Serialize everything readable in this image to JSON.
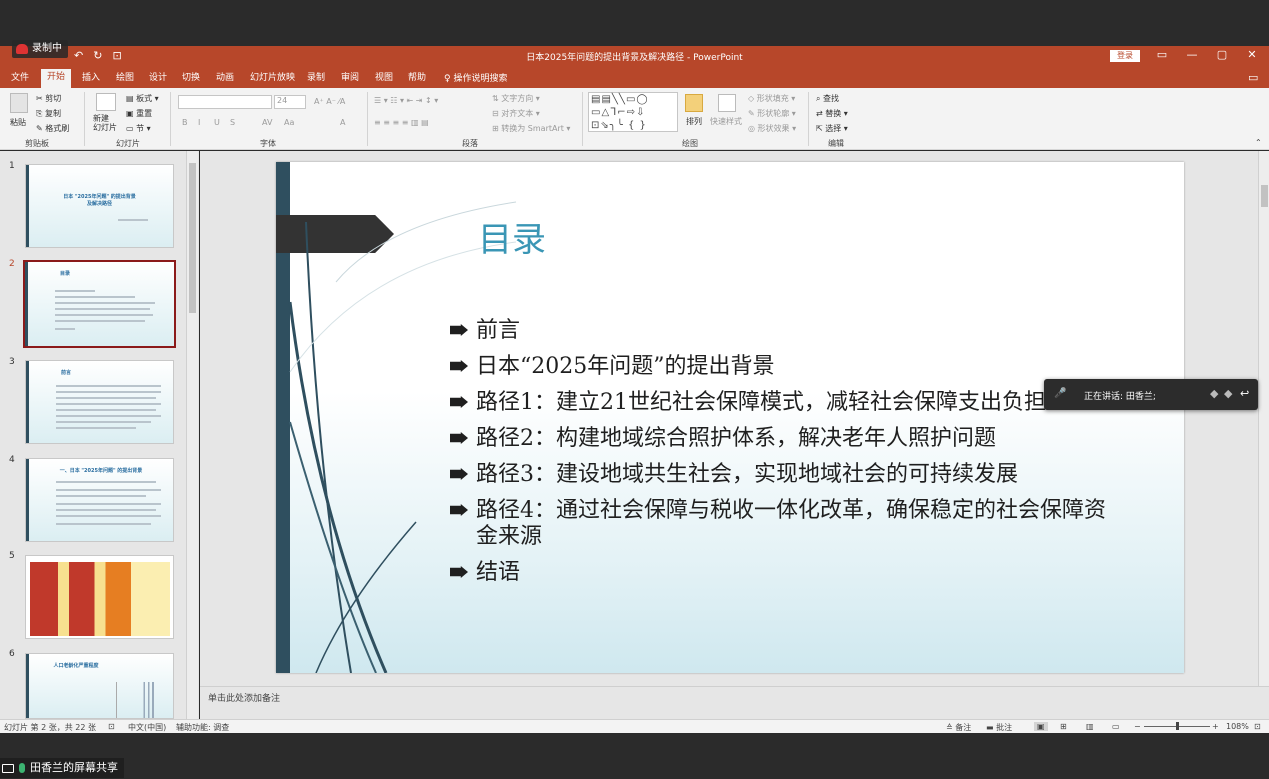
{
  "recording": {
    "label": "录制中"
  },
  "window": {
    "title": "日本2025年问题的提出背景及解决路径  -  PowerPoint",
    "login": "登录",
    "controls": [
      "▭",
      "—",
      "▢",
      "✕"
    ]
  },
  "qat": [
    "↶",
    "↻",
    "⊡"
  ],
  "tabs": [
    "文件",
    "开始",
    "插入",
    "绘图",
    "设计",
    "切换",
    "动画",
    "幻灯片放映",
    "录制",
    "审阅",
    "视图",
    "帮助"
  ],
  "tell_me": "操作说明搜索",
  "ribbon": {
    "clipboard": {
      "paste": "粘贴",
      "cut": "剪切",
      "copy": "复制",
      "format_painter": "格式刷",
      "label": "剪贴板"
    },
    "slides": {
      "new_slide": "新建\n幻灯片",
      "layout": "板式",
      "reset": "重置",
      "section": "节",
      "label": "幻灯片"
    },
    "font": {
      "size": "24",
      "label": "字体",
      "buttons": [
        "B",
        "I",
        "U",
        "S",
        "AV",
        "Aa",
        "A"
      ]
    },
    "paragraph": {
      "text_direction": "文字方向",
      "align_text": "对齐文本",
      "smartart": "转换为 SmartArt",
      "label": "段落"
    },
    "drawing": {
      "arrange": "排列",
      "quick_styles": "快速样式",
      "fill": "形状填充",
      "outline": "形状轮廓",
      "effects": "形状效果",
      "label": "绘图"
    },
    "editing": {
      "find": "查找",
      "replace": "替换",
      "select": "选择",
      "label": "编辑"
    }
  },
  "thumbnails": [
    {
      "num": "1",
      "title": "日本 \"2025年问题\" 的提出背景\n及解决路径"
    },
    {
      "num": "2",
      "title": "目录"
    },
    {
      "num": "3",
      "title": "前言"
    },
    {
      "num": "4",
      "title": "一、日本 \"2025年问题\" 的提出背景"
    },
    {
      "num": "5",
      "title": ""
    },
    {
      "num": "6",
      "title": "人口老龄化严重程度"
    }
  ],
  "slide": {
    "title": "目录",
    "bullets": [
      "前言",
      "日本“2025年问题”的提出背景",
      "路径1：建立21世纪社会保障模式，减轻社会保障支出负担",
      "路径2：构建地域综合照护体系，解决老年人照护问题",
      "路径3：建设地域共生社会，实现地域社会的可持续发展",
      "路径4：通过社会保障与税收一体化改革，确保稳定的社会保障资金来源",
      "结语"
    ]
  },
  "notes": {
    "placeholder": "单击此处添加备注"
  },
  "status": {
    "slide_info": "幻灯片 第 2 张，共 22 张",
    "language": "中文(中国)",
    "accessibility": "辅助功能: 调查",
    "notes_btn": "备注",
    "comments_btn": "批注",
    "zoom": "108%"
  },
  "speaker": {
    "text": "正在讲话: 田香兰;"
  },
  "share": {
    "text": "田香兰的屏幕共享"
  }
}
